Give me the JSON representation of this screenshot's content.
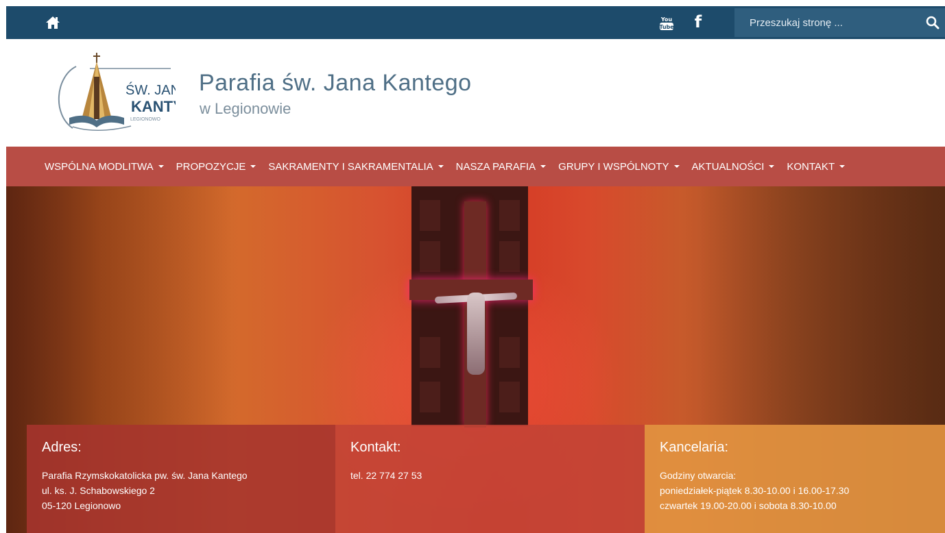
{
  "topbar": {
    "icons": [
      "home-icon",
      "youtube-icon",
      "facebook-icon",
      "search-icon"
    ],
    "facebook_glyph": "f",
    "search_placeholder": "Przeszukaj stronę ..."
  },
  "header": {
    "logo": {
      "line1": "ŚW. JAN",
      "line2": "KANTY",
      "line3": "LEGIONOWO"
    },
    "title": "Parafia św. Jana Kantego",
    "subtitle": "w Legionowie"
  },
  "nav": {
    "items": [
      {
        "label": "WSPÓLNA MODLITWA"
      },
      {
        "label": "PROPOZYCJE"
      },
      {
        "label": "SAKRAMENTY I SAKRAMENTALIA"
      },
      {
        "label": "NASZA PARAFIA"
      },
      {
        "label": "GRUPY I WSPÓLNOTY"
      },
      {
        "label": "AKTUALNOŚCI"
      },
      {
        "label": "KONTAKT"
      }
    ]
  },
  "info": {
    "adres": {
      "heading": "Adres:",
      "lines": [
        "Parafia Rzymskokatolicka pw. św. Jana Kantego",
        "ul. ks. J. Schabowskiego 2",
        "05-120 Legionowo"
      ]
    },
    "kontakt": {
      "heading": "Kontakt:",
      "lines": [
        "tel. 22 774 27 53"
      ]
    },
    "kancelaria": {
      "heading": "Kancelaria:",
      "lines": [
        "Godziny otwarcia:",
        "poniedziałek-piątek 8.30-10.00 i 16.00-17.30",
        "czwartek 19.00-20.00 i sobota 8.30-10.00"
      ]
    }
  },
  "colors": {
    "topbar": "#1d4b6b",
    "search_bg": "#2f5e7e",
    "nav": "#b84d45",
    "title": "#4f6f86",
    "box_adres": "#a6342e",
    "box_kontakt": "#c34336",
    "box_kancelaria": "#e29240"
  }
}
